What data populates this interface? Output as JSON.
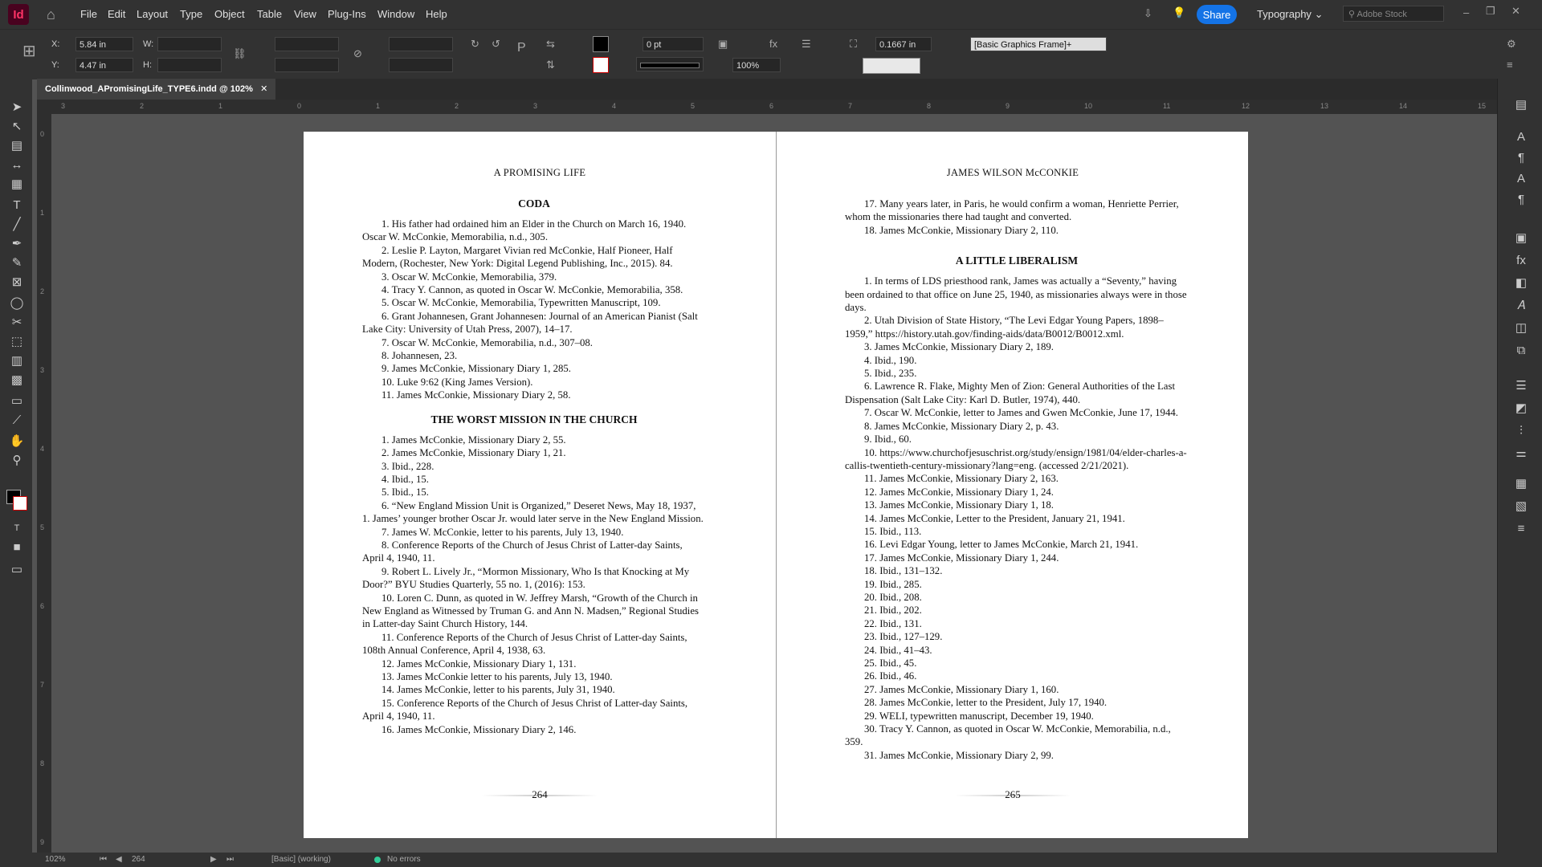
{
  "app": {
    "logo": "Id",
    "menus": [
      "File",
      "Edit",
      "Layout",
      "Type",
      "Object",
      "Table",
      "View",
      "Plug-Ins",
      "Window",
      "Help"
    ],
    "share_label": "Share",
    "workspace": "Typography",
    "stock_placeholder": "Adobe Stock"
  },
  "control": {
    "x_label": "X:",
    "x_value": "5.84 in",
    "y_label": "Y:",
    "y_value": "4.47 in",
    "w_label": "W:",
    "h_label": "H:",
    "stroke_weight": "0 pt",
    "opacity": "100%",
    "offset": "0.1667 in",
    "object_style": "[Basic Graphics Frame]+"
  },
  "document": {
    "tab_title": "Collinwood_APromisingLife_TYPE6.indd @ 102%",
    "ruler_labels": [
      "3",
      "2",
      "1",
      "0",
      "1",
      "2",
      "3",
      "4",
      "5",
      "6",
      "7",
      "8",
      "9",
      "10",
      "11",
      "12",
      "13",
      "14",
      "15"
    ],
    "vruler_labels": [
      "0",
      "1",
      "2",
      "3",
      "4",
      "5",
      "6",
      "7",
      "8",
      "9"
    ]
  },
  "left_page": {
    "running_head": "A PROMISING LIFE",
    "sections": [
      {
        "title": "CODA",
        "notes": [
          "1. His father had ordained him an Elder in the Church on March 16, 1940. Oscar W. McConkie, Memorabilia, n.d., 305.",
          "2. Leslie P. Layton, Margaret Vivian red McConkie, Half Pioneer, Half Modern, (Rochester, New York: Digital Legend Publishing, Inc., 2015). 84.",
          "3. Oscar W. McConkie, Memorabilia, 379.",
          "4. Tracy Y. Cannon, as quoted in Oscar W. McConkie, Memorabilia, 358.",
          "5. Oscar W. McConkie, Memorabilia, Typewritten Manuscript, 109.",
          "6. Grant Johannesen, Grant Johannesen: Journal of an American Pianist (Salt Lake City: University of Utah Press, 2007), 14–17.",
          "7. Oscar W. McConkie, Memorabilia, n.d., 307–08.",
          "8. Johannesen, 23.",
          "9. James McConkie, Missionary Diary 1, 285.",
          "10. Luke 9:62 (King James Version).",
          "11. James McConkie, Missionary Diary 2, 58."
        ]
      },
      {
        "title": "THE WORST MISSION IN THE CHURCH",
        "notes": [
          "1. James McConkie, Missionary Diary 2, 55.",
          "2. James McConkie, Missionary Diary 1, 21.",
          "3. Ibid., 228.",
          "4. Ibid., 15.",
          "5. Ibid., 15.",
          "6. “New England Mission Unit is Organized,” Deseret News, May 18, 1937, 1. James’ younger brother Oscar Jr. would later serve in the New England Mission.",
          "7. James W. McConkie, letter to his parents, July 13, 1940.",
          "8. Conference Reports of the Church of Jesus Christ of Latter-day Saints, April 4, 1940, 11.",
          "9. Robert L. Lively Jr., “Mormon Missionary, Who Is that Knocking at My Door?” BYU Studies Quarterly, 55 no. 1, (2016): 153.",
          "10. Loren C. Dunn, as quoted in W. Jeffrey Marsh, “Growth of the Church in New England as Witnessed by Truman G. and Ann N. Madsen,” Regional Studies in Latter-day Saint Church History, 144.",
          "11. Conference Reports of the Church of Jesus Christ of Latter-day Saints, 108th Annual Conference, April 4, 1938, 63.",
          "12. James McConkie, Missionary Diary 1, 131.",
          "13. James McConkie letter to his parents, July 13, 1940.",
          "14. James McConkie, letter to his parents, July 31, 1940.",
          "15. Conference Reports of the Church of Jesus Christ of Latter-day Saints, April 4, 1940, 11.",
          "16. James McConkie, Missionary Diary 2, 146."
        ]
      }
    ],
    "folio": "264"
  },
  "right_page": {
    "running_head": "JAMES WILSON McCONKIE",
    "carryover": [
      "17. Many years later, in Paris, he would confirm a woman, Henriette Perrier, whom the missionaries there had taught and converted.",
      "18. James McConkie, Missionary Diary 2, 110."
    ],
    "section_title": "A LITTLE LIBERALISM",
    "notes": [
      "1. In terms of LDS priesthood rank, James was actually a “Seventy,” having been ordained to that office on June 25, 1940, as missionaries always were in those days.",
      "2. Utah Division of State History, “The Levi Edgar Young Papers, 1898–1959,” https://history.utah.gov/finding-aids/data/B0012/B0012.xml.",
      "3. James McConkie, Missionary Diary 2, 189.",
      "4. Ibid., 190.",
      "5. Ibid., 235.",
      "6. Lawrence R. Flake, Mighty Men of Zion: General Authorities of the Last Dispensation (Salt Lake City: Karl D. Butler, 1974), 440.",
      "7. Oscar W. McConkie, letter to James and Gwen McConkie, June 17, 1944.",
      "8. James McConkie, Missionary Diary 2, p. 43.",
      "9. Ibid., 60.",
      "10. https://www.churchofjesuschrist.org/study/ensign/1981/04/elder-charles-a-callis-twentieth-century-missionary?lang=eng. (accessed 2/21/2021).",
      "11. James McConkie, Missionary Diary 2, 163.",
      "12. James McConkie, Missionary Diary 1, 24.",
      "13. James McConkie, Missionary Diary 1, 18.",
      "14. James McConkie, Letter to the President, January 21, 1941.",
      "15. Ibid., 113.",
      "16. Levi Edgar Young, letter to James McConkie, March 21, 1941.",
      "17. James McConkie, Missionary Diary 1, 244.",
      "18. Ibid., 131–132.",
      "19. Ibid., 285.",
      "20. Ibid., 208.",
      "21. Ibid., 202.",
      "22. Ibid., 131.",
      "23. Ibid., 127–129.",
      "24. Ibid., 41–43.",
      "25. Ibid., 45.",
      "26. Ibid., 46.",
      "27. James McConkie, Missionary Diary 1, 160.",
      "28. James McConkie, letter to the President, July 17, 1940.",
      "29. WELI, typewritten manuscript, December 19, 1940.",
      "30. Tracy Y. Cannon, as quoted in Oscar W. McConkie, Memorabilia, n.d., 359.",
      "31. James McConkie, Missionary Diary 2, 99."
    ],
    "folio": "265"
  },
  "status": {
    "zoom": "102%",
    "page": "264",
    "profile": "[Basic] (working)",
    "errors": "No errors"
  },
  "colors": {
    "accent": "#1473e6",
    "app_bg": "#535353",
    "chrome": "#323232"
  }
}
